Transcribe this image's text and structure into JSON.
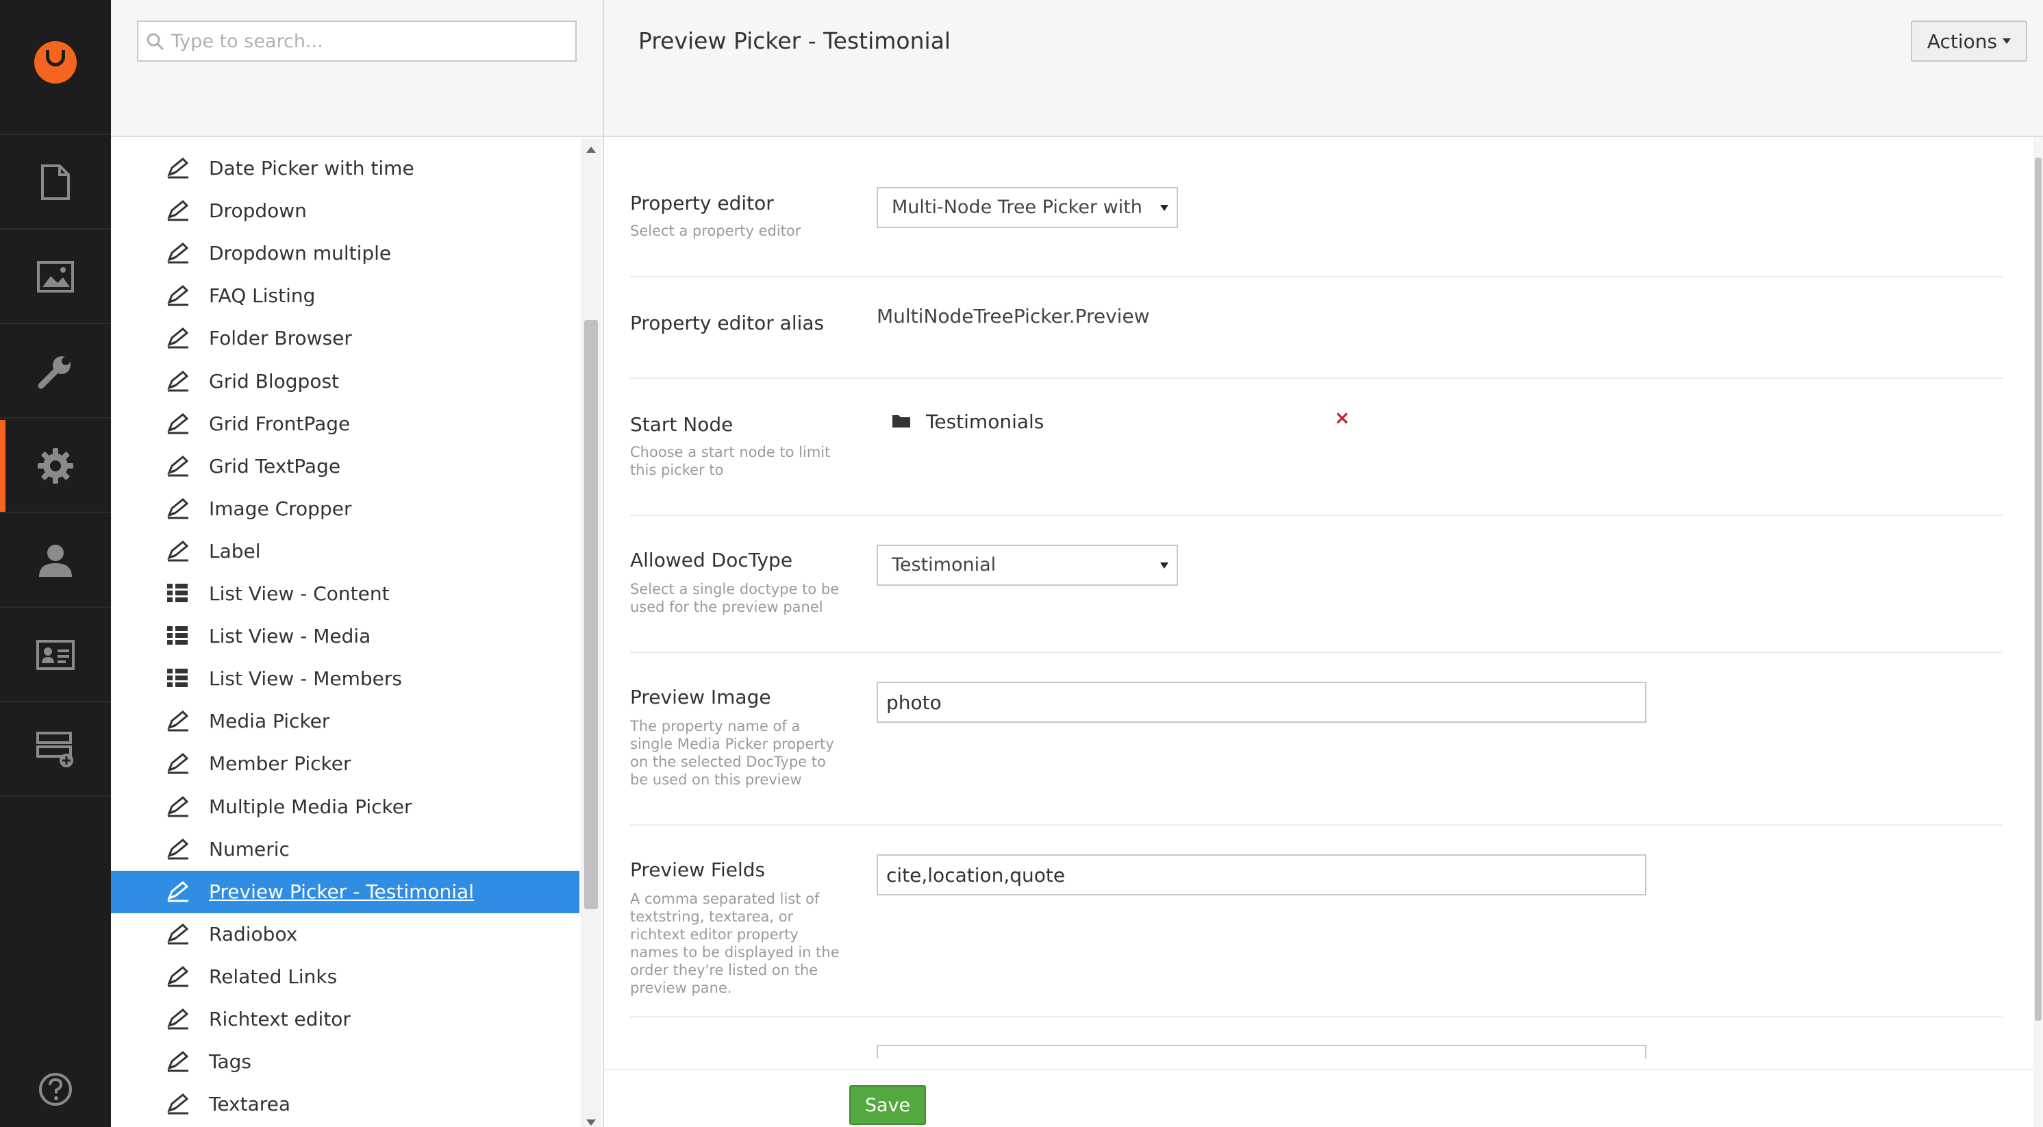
{
  "brand": {
    "accent": "#f5651f",
    "selected": "#2f8de4",
    "save": "#53a93f"
  },
  "rail": {
    "logo_icon": "umbraco-logo-icon",
    "items": [
      {
        "name": "content-section",
        "icon": "document-icon",
        "active": false
      },
      {
        "name": "media-section",
        "icon": "image-icon",
        "active": false
      },
      {
        "name": "developer-section",
        "icon": "wrench-icon",
        "active": false
      },
      {
        "name": "settings-section",
        "icon": "gear-icon",
        "active": true
      },
      {
        "name": "users-section",
        "icon": "user-icon",
        "active": false
      },
      {
        "name": "members-section",
        "icon": "id-card-icon",
        "active": false
      },
      {
        "name": "forms-section",
        "icon": "forms-icon",
        "active": false
      }
    ],
    "help_icon": "help-icon"
  },
  "search": {
    "placeholder": "Type to search..."
  },
  "tree": {
    "items": [
      {
        "label": "Date Picker with time",
        "icon": "edit-icon"
      },
      {
        "label": "Dropdown",
        "icon": "edit-icon"
      },
      {
        "label": "Dropdown multiple",
        "icon": "edit-icon"
      },
      {
        "label": "FAQ Listing",
        "icon": "edit-icon"
      },
      {
        "label": "Folder Browser",
        "icon": "edit-icon"
      },
      {
        "label": "Grid Blogpost",
        "icon": "edit-icon"
      },
      {
        "label": "Grid FrontPage",
        "icon": "edit-icon"
      },
      {
        "label": "Grid TextPage",
        "icon": "edit-icon"
      },
      {
        "label": "Image Cropper",
        "icon": "edit-icon"
      },
      {
        "label": "Label",
        "icon": "edit-icon"
      },
      {
        "label": "List View - Content",
        "icon": "list-icon"
      },
      {
        "label": "List View - Media",
        "icon": "list-icon"
      },
      {
        "label": "List View - Members",
        "icon": "list-icon"
      },
      {
        "label": "Media Picker",
        "icon": "edit-icon"
      },
      {
        "label": "Member Picker",
        "icon": "edit-icon"
      },
      {
        "label": "Multiple Media Picker",
        "icon": "edit-icon"
      },
      {
        "label": "Numeric",
        "icon": "edit-icon"
      },
      {
        "label": "Preview Picker - Testimonial",
        "icon": "edit-icon",
        "selected": true
      },
      {
        "label": "Radiobox",
        "icon": "edit-icon"
      },
      {
        "label": "Related Links",
        "icon": "edit-icon"
      },
      {
        "label": "Richtext editor",
        "icon": "edit-icon"
      },
      {
        "label": "Tags",
        "icon": "edit-icon"
      },
      {
        "label": "Textarea",
        "icon": "edit-icon"
      }
    ]
  },
  "header": {
    "title": "Preview Picker - Testimonial",
    "actions_label": "Actions"
  },
  "properties": {
    "property_editor": {
      "label": "Property editor",
      "description": "Select a property editor",
      "value": "Multi-Node Tree Picker with"
    },
    "property_editor_alias": {
      "label": "Property editor alias",
      "value": "MultiNodeTreePicker.Preview"
    },
    "start_node": {
      "label": "Start Node",
      "description": "Choose a start node to limit this picker to",
      "node_label": "Testimonials",
      "node_icon": "folder-icon",
      "remove_symbol": "×"
    },
    "allowed_doctype": {
      "label": "Allowed DocType",
      "description": "Select a single doctype to be used for the preview panel",
      "value": "Testimonial"
    },
    "preview_image": {
      "label": "Preview Image",
      "description": "The property name of a single Media Picker property on the selected DocType to be used on this preview",
      "value": "photo"
    },
    "preview_fields": {
      "label": "Preview Fields",
      "description": "A comma separated list of textstring, textarea, or richtext editor property names to be displayed in the order they're listed on the preview pane.",
      "value": "cite,location,quote"
    }
  },
  "footer": {
    "save_label": "Save"
  }
}
